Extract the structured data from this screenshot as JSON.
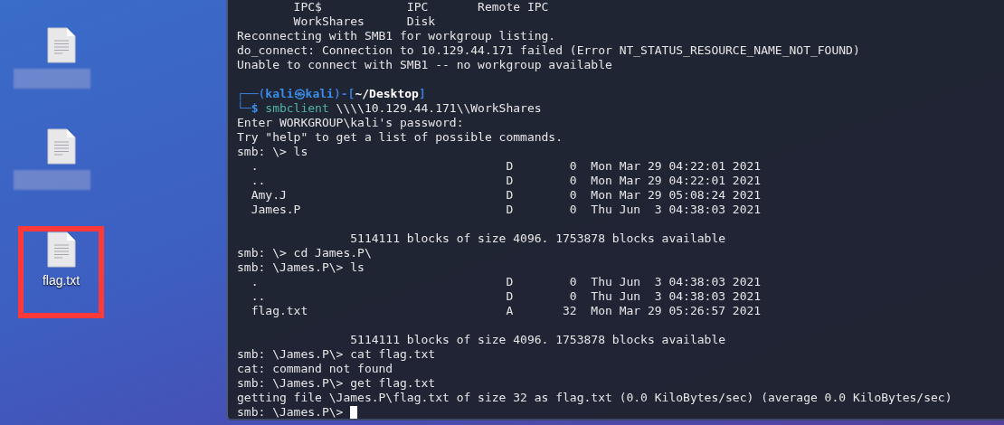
{
  "desktop": {
    "icons": [
      {
        "label_blurred": true,
        "highlighted": false
      },
      {
        "label_blurred": true,
        "highlighted": false
      },
      {
        "label": "flag.txt",
        "label_blurred": false,
        "highlighted": true
      }
    ]
  },
  "terminal": {
    "lines": [
      {
        "kind": "output",
        "text": "        IPC$            IPC       Remote IPC"
      },
      {
        "kind": "output",
        "text": "        WorkShares      Disk"
      },
      {
        "kind": "output",
        "text": "Reconnecting with SMB1 for workgroup listing."
      },
      {
        "kind": "output",
        "text": "do_connect: Connection to 10.129.44.171 failed (Error NT_STATUS_RESOURCE_NAME_NOT_FOUND)"
      },
      {
        "kind": "output",
        "text": "Unable to connect with SMB1 -- no workgroup available"
      },
      {
        "kind": "blank"
      },
      {
        "kind": "prompt",
        "segments": [
          {
            "kind": "frame",
            "text": "┌──("
          },
          {
            "kind": "user",
            "text": "kali㉿kali"
          },
          {
            "kind": "frame",
            "text": ")-["
          },
          {
            "kind": "path",
            "text": "~/Desktop"
          },
          {
            "kind": "frame",
            "text": "]"
          }
        ]
      },
      {
        "kind": "prompt",
        "segments": [
          {
            "kind": "frame",
            "text": "└─"
          },
          {
            "kind": "dollar",
            "text": "$"
          },
          {
            "kind": "command",
            "text": " smbclient "
          },
          {
            "kind": "arg",
            "text": "\\\\\\\\10.129.44.171\\\\WorkShares"
          }
        ]
      },
      {
        "kind": "output",
        "text": "Enter WORKGROUP\\kali's password: "
      },
      {
        "kind": "output",
        "text": "Try \"help\" to get a list of possible commands."
      },
      {
        "kind": "output",
        "text": "smb: \\> ls"
      },
      {
        "kind": "output",
        "text": "  .                                   D        0  Mon Mar 29 04:22:01 2021"
      },
      {
        "kind": "output",
        "text": "  ..                                  D        0  Mon Mar 29 04:22:01 2021"
      },
      {
        "kind": "output",
        "text": "  Amy.J                               D        0  Mon Mar 29 05:08:24 2021"
      },
      {
        "kind": "output",
        "text": "  James.P                             D        0  Thu Jun  3 04:38:03 2021"
      },
      {
        "kind": "blank"
      },
      {
        "kind": "output",
        "text": "                5114111 blocks of size 4096. 1753878 blocks available"
      },
      {
        "kind": "output",
        "text": "smb: \\> cd James.P\\"
      },
      {
        "kind": "output",
        "text": "smb: \\James.P\\> ls"
      },
      {
        "kind": "output",
        "text": "  .                                   D        0  Thu Jun  3 04:38:03 2021"
      },
      {
        "kind": "output",
        "text": "  ..                                  D        0  Thu Jun  3 04:38:03 2021"
      },
      {
        "kind": "output",
        "text": "  flag.txt                            A       32  Mon Mar 29 05:26:57 2021"
      },
      {
        "kind": "blank"
      },
      {
        "kind": "output",
        "text": "                5114111 blocks of size 4096. 1753878 blocks available"
      },
      {
        "kind": "output",
        "text": "smb: \\James.P\\> cat flag.txt"
      },
      {
        "kind": "output",
        "text": "cat: command not found"
      },
      {
        "kind": "output",
        "text": "smb: \\James.P\\> get flag.txt"
      },
      {
        "kind": "output",
        "text": "getting file \\James.P\\flag.txt of size 32 as flag.txt (0.0 KiloBytes/sec) (average 0.0 KiloBytes/sec)"
      },
      {
        "kind": "input",
        "text": "smb: \\James.P\\> ",
        "cursor": true
      }
    ]
  }
}
